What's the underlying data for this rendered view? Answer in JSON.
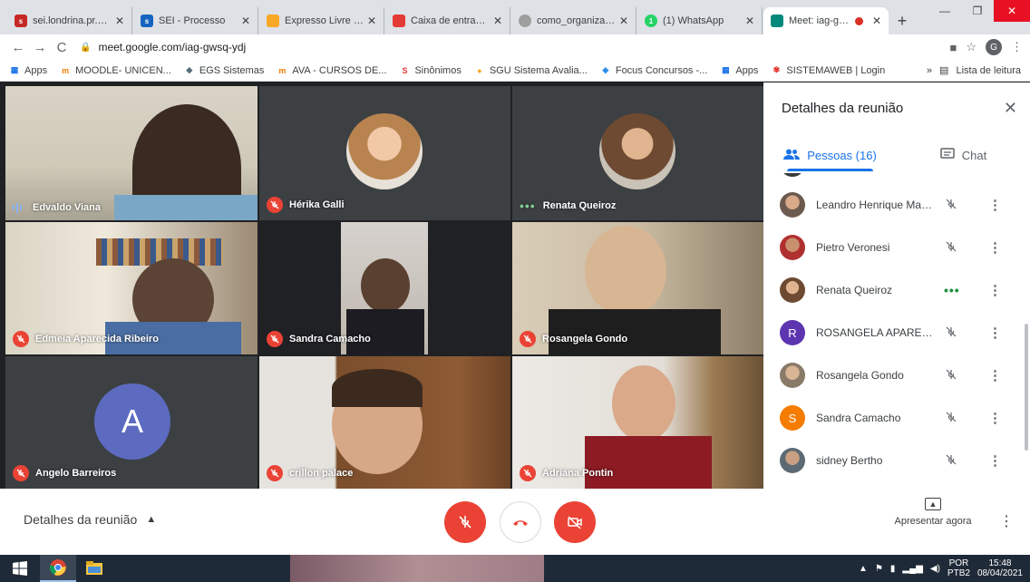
{
  "browser": {
    "tabs": [
      {
        "title": "sei.londrina.pr.gov.",
        "favicon": "sei-icon",
        "color": "#c62828",
        "active": false
      },
      {
        "title": "SEI - Processo",
        "favicon": "sei-icon",
        "color": "#1565c0",
        "active": false
      },
      {
        "title": "Expresso Livre [Exp",
        "favicon": "expresso-icon",
        "color": "#f9a825",
        "active": false
      },
      {
        "title": "Caixa de entrada (",
        "favicon": "mail-icon",
        "color": "#e53935",
        "active": false
      },
      {
        "title": "como_organizar_un",
        "favicon": "globe-icon",
        "color": "#9e9e9e",
        "active": false
      },
      {
        "title": "(1) WhatsApp",
        "favicon": "whatsapp-icon",
        "color": "#25d366",
        "active": false
      },
      {
        "title": "Meet: iag-gwsc",
        "favicon": "meet-icon",
        "color": "#00897b",
        "active": true
      }
    ],
    "url": "meet.google.com/iag-gwsq-ydj",
    "bookmarks": [
      {
        "label": "Apps",
        "icon": "apps-grid-icon",
        "color": "#1a73e8"
      },
      {
        "label": "MOODLE- UNICEN...",
        "icon": "moodle-icon",
        "color": "#f57c00"
      },
      {
        "label": "EGS Sistemas",
        "icon": "egs-icon",
        "color": "#546e7a"
      },
      {
        "label": "AVA - CURSOS DE...",
        "icon": "moodle-icon",
        "color": "#f57c00"
      },
      {
        "label": "Sinônimos",
        "icon": "sinonimos-icon",
        "color": "#e53935"
      },
      {
        "label": "SGU Sistema Avalia...",
        "icon": "sgu-icon",
        "color": "#f9a825"
      },
      {
        "label": "Focus Concursos -...",
        "icon": "focus-icon",
        "color": "#1e88e5"
      },
      {
        "label": "Apps",
        "icon": "apps-grid-icon",
        "color": "#1a73e8"
      },
      {
        "label": "SISTEMAWEB | Login",
        "icon": "sistemaweb-icon",
        "color": "#e53935"
      }
    ],
    "reading_list": "Lista de leitura",
    "profile_initial": "G"
  },
  "meet": {
    "tiles": [
      {
        "name": "Edvaldo Viana",
        "status": "speaking"
      },
      {
        "name": "Hérika Galli",
        "status": "muted"
      },
      {
        "name": "Renata Queiroz",
        "status": "connecting"
      },
      {
        "name": "Edmeia Aparecida Ribeiro",
        "status": "muted"
      },
      {
        "name": "Sandra Camacho",
        "status": "muted"
      },
      {
        "name": "Rosangela Gondo",
        "status": "muted"
      },
      {
        "name": "Angelo Barreiros",
        "status": "muted",
        "initial": "A"
      },
      {
        "name": "crillon palace",
        "status": "muted"
      },
      {
        "name": "Adriana Pontin",
        "status": "muted"
      }
    ],
    "controls": {
      "details_label": "Detalhes da reunião",
      "present_label": "Apresentar agora"
    },
    "panel": {
      "title": "Detalhes da reunião",
      "people_tab": "Pessoas (16)",
      "chat_tab": "Chat",
      "people": [
        {
          "name": "Leandro Henrique Mag...",
          "avatar": "photo",
          "state": "muted"
        },
        {
          "name": "Pietro Veronesi",
          "avatar": "photo",
          "state": "muted"
        },
        {
          "name": "Renata Queiroz",
          "avatar": "photo",
          "state": "connecting"
        },
        {
          "name": "ROSANGELA APARECID...",
          "avatar": "letter",
          "initial": "R",
          "color": "#5e35b1",
          "state": "muted"
        },
        {
          "name": "Rosangela Gondo",
          "avatar": "photo",
          "state": "muted"
        },
        {
          "name": "Sandra Camacho",
          "avatar": "letter",
          "initial": "S",
          "color": "#f57c00",
          "state": "muted"
        },
        {
          "name": "sidney Bertho",
          "avatar": "photo",
          "state": "muted"
        }
      ]
    }
  },
  "taskbar": {
    "language": "POR",
    "layout": "PTB2",
    "time": "15:48",
    "date": "08/04/2021"
  }
}
